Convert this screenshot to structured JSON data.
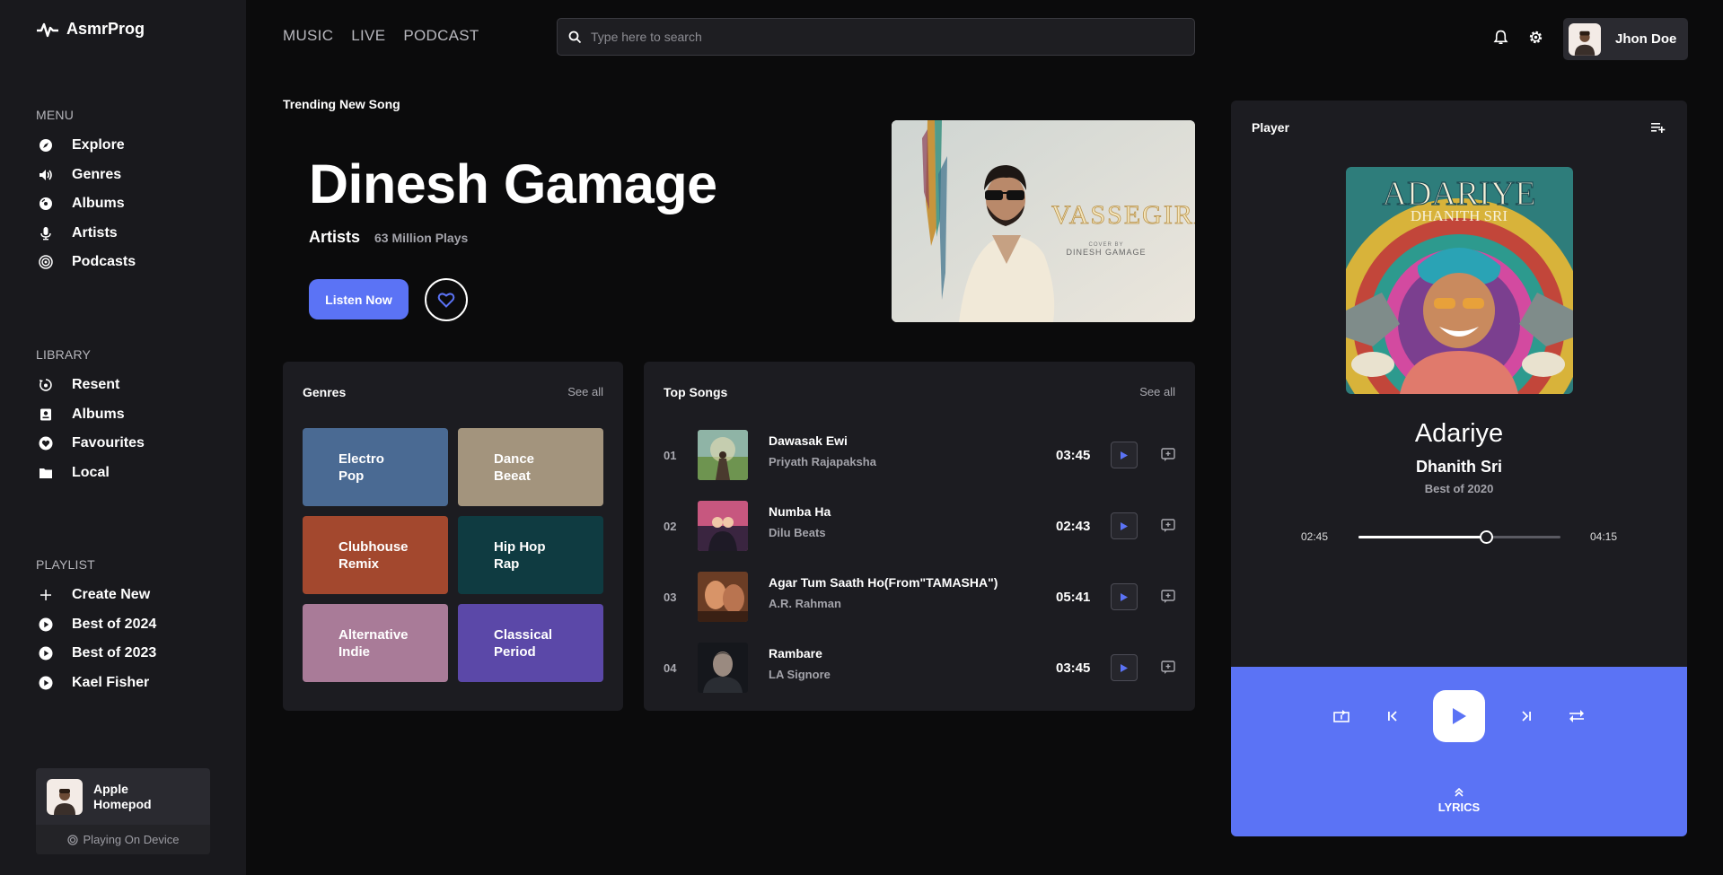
{
  "app": {
    "name": "AsmrProg"
  },
  "sidebar": {
    "menu": {
      "heading": "MENU",
      "items": [
        {
          "label": "Explore",
          "icon": "compass-icon"
        },
        {
          "label": "Genres",
          "icon": "speaker-icon"
        },
        {
          "label": "Albums",
          "icon": "disc-icon"
        },
        {
          "label": "Artists",
          "icon": "microphone-icon"
        },
        {
          "label": "Podcasts",
          "icon": "podcast-icon"
        }
      ]
    },
    "library": {
      "heading": "LIBRARY",
      "items": [
        {
          "label": "Resent",
          "icon": "history-icon"
        },
        {
          "label": "Albums",
          "icon": "album-icon"
        },
        {
          "label": "Favourites",
          "icon": "heart-icon"
        },
        {
          "label": "Local",
          "icon": "folder-icon"
        }
      ]
    },
    "playlist": {
      "heading": "PLAYLIST",
      "items": [
        {
          "label": "Create New",
          "icon": "plus-icon"
        },
        {
          "label": "Best of 2024",
          "icon": "play-circle-icon"
        },
        {
          "label": "Best of 2023",
          "icon": "play-circle-icon"
        },
        {
          "label": "Kael Fisher",
          "icon": "play-circle-icon"
        }
      ]
    },
    "device": {
      "name": "Apple Homepod",
      "status": "Playing On Device"
    }
  },
  "header": {
    "tabs": [
      "MUSIC",
      "LIVE",
      "PODCAST"
    ],
    "search_placeholder": "Type here to search",
    "user_name": "Jhon Doe"
  },
  "hero": {
    "label": "Trending New Song",
    "artist": "Dinesh Gamage",
    "role": "Artists",
    "plays": "63 Million Plays",
    "listen_label": "Listen Now",
    "image_text": "VASSEGIRA",
    "image_caption_1": "COVER BY",
    "image_caption_2": "DINESH GAMAGE"
  },
  "genres": {
    "title": "Genres",
    "see_all": "See all",
    "items": [
      {
        "label": "Electro Pop",
        "color": "#4a6a93"
      },
      {
        "label": "Dance Beeat",
        "color": "#a3947d"
      },
      {
        "label": "Clubhouse Remix",
        "color": "#a3482e"
      },
      {
        "label": "Hip Hop Rap",
        "color": "#0f3b41"
      },
      {
        "label": "Alternative Indie",
        "color": "#a97b98"
      },
      {
        "label": "Classical Period",
        "color": "#5b48a8"
      }
    ]
  },
  "top_songs": {
    "title": "Top Songs",
    "see_all": "See all",
    "items": [
      {
        "num": "01",
        "name": "Dawasak Ewi",
        "artist": "Priyath Rajapaksha",
        "time": "03:45"
      },
      {
        "num": "02",
        "name": "Numba Ha",
        "artist": "Dilu Beats",
        "time": "02:43"
      },
      {
        "num": "03",
        "name": "Agar Tum Saath Ho(From\"TAMASHA\")",
        "artist": "A.R. Rahman",
        "time": "05:41"
      },
      {
        "num": "04",
        "name": "Rambare",
        "artist": "LA Signore",
        "time": "03:45"
      }
    ]
  },
  "player": {
    "title": "Player",
    "cover_title": "ADARIYE",
    "cover_subtitle": "DHANITH SRI",
    "track": "Adariye",
    "artist": "Dhanith Sri",
    "album": "Best of 2020",
    "time_current": "02:45",
    "time_total": "04:15",
    "progress": 0.63,
    "lyrics_label": "LYRICS"
  },
  "colors": {
    "accent": "#5b73f5",
    "background": "#0b0b0c",
    "panel": "#1c1c21"
  }
}
